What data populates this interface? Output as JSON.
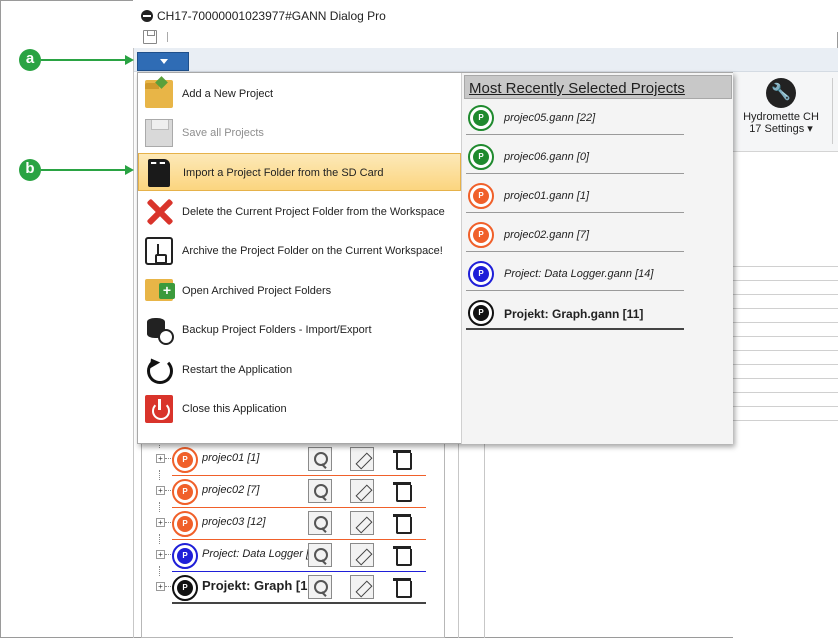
{
  "window": {
    "title": "CH17-70000001023977#GANN Dialog Pro"
  },
  "annotations": {
    "a": "a",
    "b": "b"
  },
  "ribbon": {
    "hydromette_label_line1": "Hydromette CH",
    "hydromette_label_line2": "17 Settings ▾",
    "hydromette_icon": "wrench-icon"
  },
  "menu": {
    "items": [
      {
        "label": "Add a New Project",
        "icon": "folder-open-icon",
        "enabled": true
      },
      {
        "label": "Save all Projects",
        "icon": "save-icon",
        "enabled": false
      },
      {
        "label": "Import a Project Folder from the SD Card",
        "icon": "sd-card-icon",
        "enabled": true,
        "highlighted": true
      },
      {
        "label": "Delete the Current Project Folder from the Workspace",
        "icon": "delete-x-icon",
        "enabled": true
      },
      {
        "label": "Archive the Project Folder on the Current Workspace!",
        "icon": "archive-icon",
        "enabled": true
      },
      {
        "label": "Open Archived Project Folders",
        "icon": "folder-plus-icon",
        "enabled": true
      },
      {
        "label": "Backup Project Folders - Import/Export",
        "icon": "database-backup-icon",
        "enabled": true
      },
      {
        "label": "Restart the Application",
        "icon": "restart-icon",
        "enabled": true
      },
      {
        "label": "Close this Application",
        "icon": "power-icon",
        "enabled": true
      }
    ],
    "recent_header": "Most Recently Selected Projects",
    "recent": [
      {
        "name": "projec05.gann [22]",
        "color": "#1f8a2e",
        "bold": false
      },
      {
        "name": "projec06.gann [0]",
        "color": "#1f8a2e",
        "bold": false
      },
      {
        "name": "projec01.gann [1]",
        "color": "#f0602a",
        "bold": false
      },
      {
        "name": "projec02.gann [7]",
        "color": "#f0602a",
        "bold": false
      },
      {
        "name": "Project: Data Logger.gann [14]",
        "color": "#1f1fd8",
        "bold": false
      },
      {
        "name": "Projekt: Graph.gann [11]",
        "color": "#111111",
        "bold": true
      }
    ]
  },
  "tree": {
    "items": [
      {
        "label": "projec01 [1]",
        "color": "#f0602a",
        "bold": false
      },
      {
        "label": "projec02 [7]",
        "color": "#f0602a",
        "bold": false
      },
      {
        "label": "projec03 [12]",
        "color": "#f0602a",
        "bold": false
      },
      {
        "label": "Project: Data Logger [1",
        "color": "#1f1fd8",
        "bold": false
      },
      {
        "label": "Projekt: Graph [1",
        "color": "#111111",
        "bold": true
      }
    ],
    "badge_letter": "P"
  },
  "colors": {
    "menu_button": "#2f6cb5",
    "highlight": "#fbd57f",
    "annotation_green": "#2aa343"
  }
}
